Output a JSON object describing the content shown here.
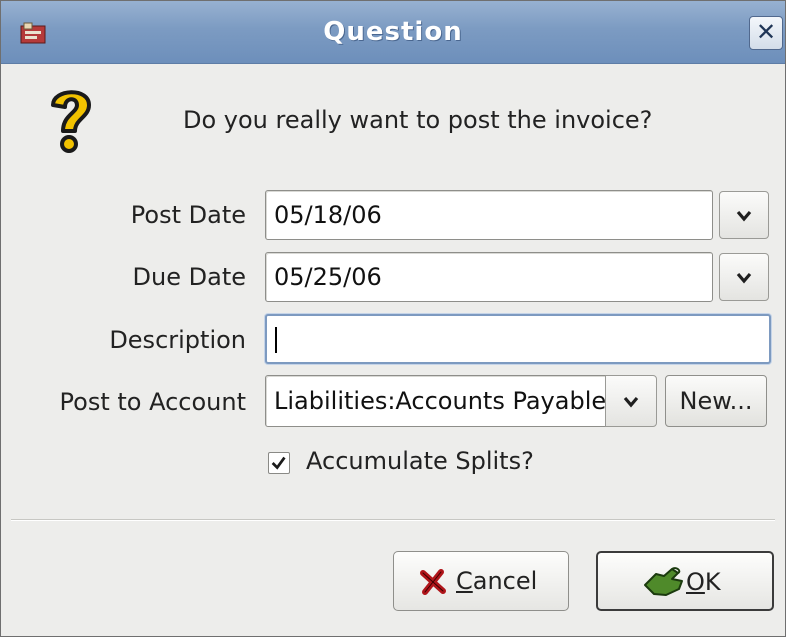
{
  "window": {
    "title": "Question",
    "close_glyph": "✕",
    "app_icon": "gnucash-app-icon"
  },
  "dialog": {
    "icon": "question-icon",
    "message": "Do you really want to post the invoice?"
  },
  "form": {
    "post_date": {
      "label": "Post Date",
      "value": "05/18/06"
    },
    "due_date": {
      "label": "Due Date",
      "value": "05/25/06"
    },
    "description": {
      "label": "Description",
      "value": ""
    },
    "post_to_account": {
      "label": "Post to Account",
      "value": "Liabilities:Accounts Payable",
      "new_button": "New..."
    },
    "accumulate_splits": {
      "label": "Accumulate Splits?",
      "checked": true
    }
  },
  "buttons": {
    "cancel": {
      "mnemonic": "C",
      "rest": "ancel",
      "icon": "cancel-x-icon"
    },
    "ok": {
      "mnemonic": "O",
      "rest": "K",
      "icon": "ok-hand-icon"
    }
  },
  "colors": {
    "titlebar": "#7c9bc2",
    "window_bg": "#ededeb",
    "focus_border": "#7d9ac0",
    "cancel_icon": "#b0151a",
    "ok_icon": "#4f8a2a"
  }
}
